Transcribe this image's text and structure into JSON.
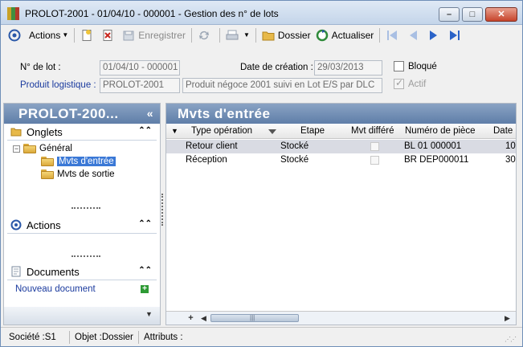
{
  "window": {
    "title": "PROLOT-2001 - 01/04/10 - 000001 -  Gestion des n° de lots",
    "controls": {
      "minimize": "–",
      "maximize": "□",
      "close": "✕"
    }
  },
  "toolbar": {
    "actions": "Actions",
    "enregistrer": "Enregistrer",
    "dossier": "Dossier",
    "actualiser": "Actualiser"
  },
  "form": {
    "lot_label": "N° de lot :",
    "lot_value": "01/04/10 - 000001",
    "date_label": "Date de création :",
    "date_value": "29/03/2013",
    "bloque_label": "Bloqué",
    "actif_label": "Actif",
    "produit_label": "Produit logistique :",
    "produit_code": "PROLOT-2001",
    "produit_desc": "Produit négoce 2001 suivi en Lot E/S par DLC"
  },
  "left_panel": {
    "title": "PROLOT-200...",
    "collapse_glyph": "«",
    "onglets": {
      "title": "Onglets",
      "tree": {
        "root": "Général",
        "children": [
          "Mvts d'entrée",
          "Mvts de sortie"
        ]
      }
    },
    "actions": {
      "title": "Actions"
    },
    "documents": {
      "title": "Documents",
      "new_doc": "Nouveau document"
    }
  },
  "right_panel": {
    "title": "Mvts d'entrée",
    "columns": [
      "Type opération",
      "Etape",
      "Mvt différé",
      "Numéro de pièce",
      "Date"
    ],
    "rows": [
      {
        "type": "Retour client",
        "etape": "Stocké",
        "numero": "BL 01 000001",
        "date": "10"
      },
      {
        "type": "Réception",
        "etape": "Stocké",
        "numero": "BR DEP000011",
        "date": "30"
      }
    ]
  },
  "statusbar": {
    "societe": "Société :S1",
    "objet": "Objet :Dossier",
    "attributs": "Attributs :"
  },
  "colors": {
    "panel_header": "#5f7ea8",
    "selection": "#3a78d6",
    "link": "#1a3a9e"
  }
}
